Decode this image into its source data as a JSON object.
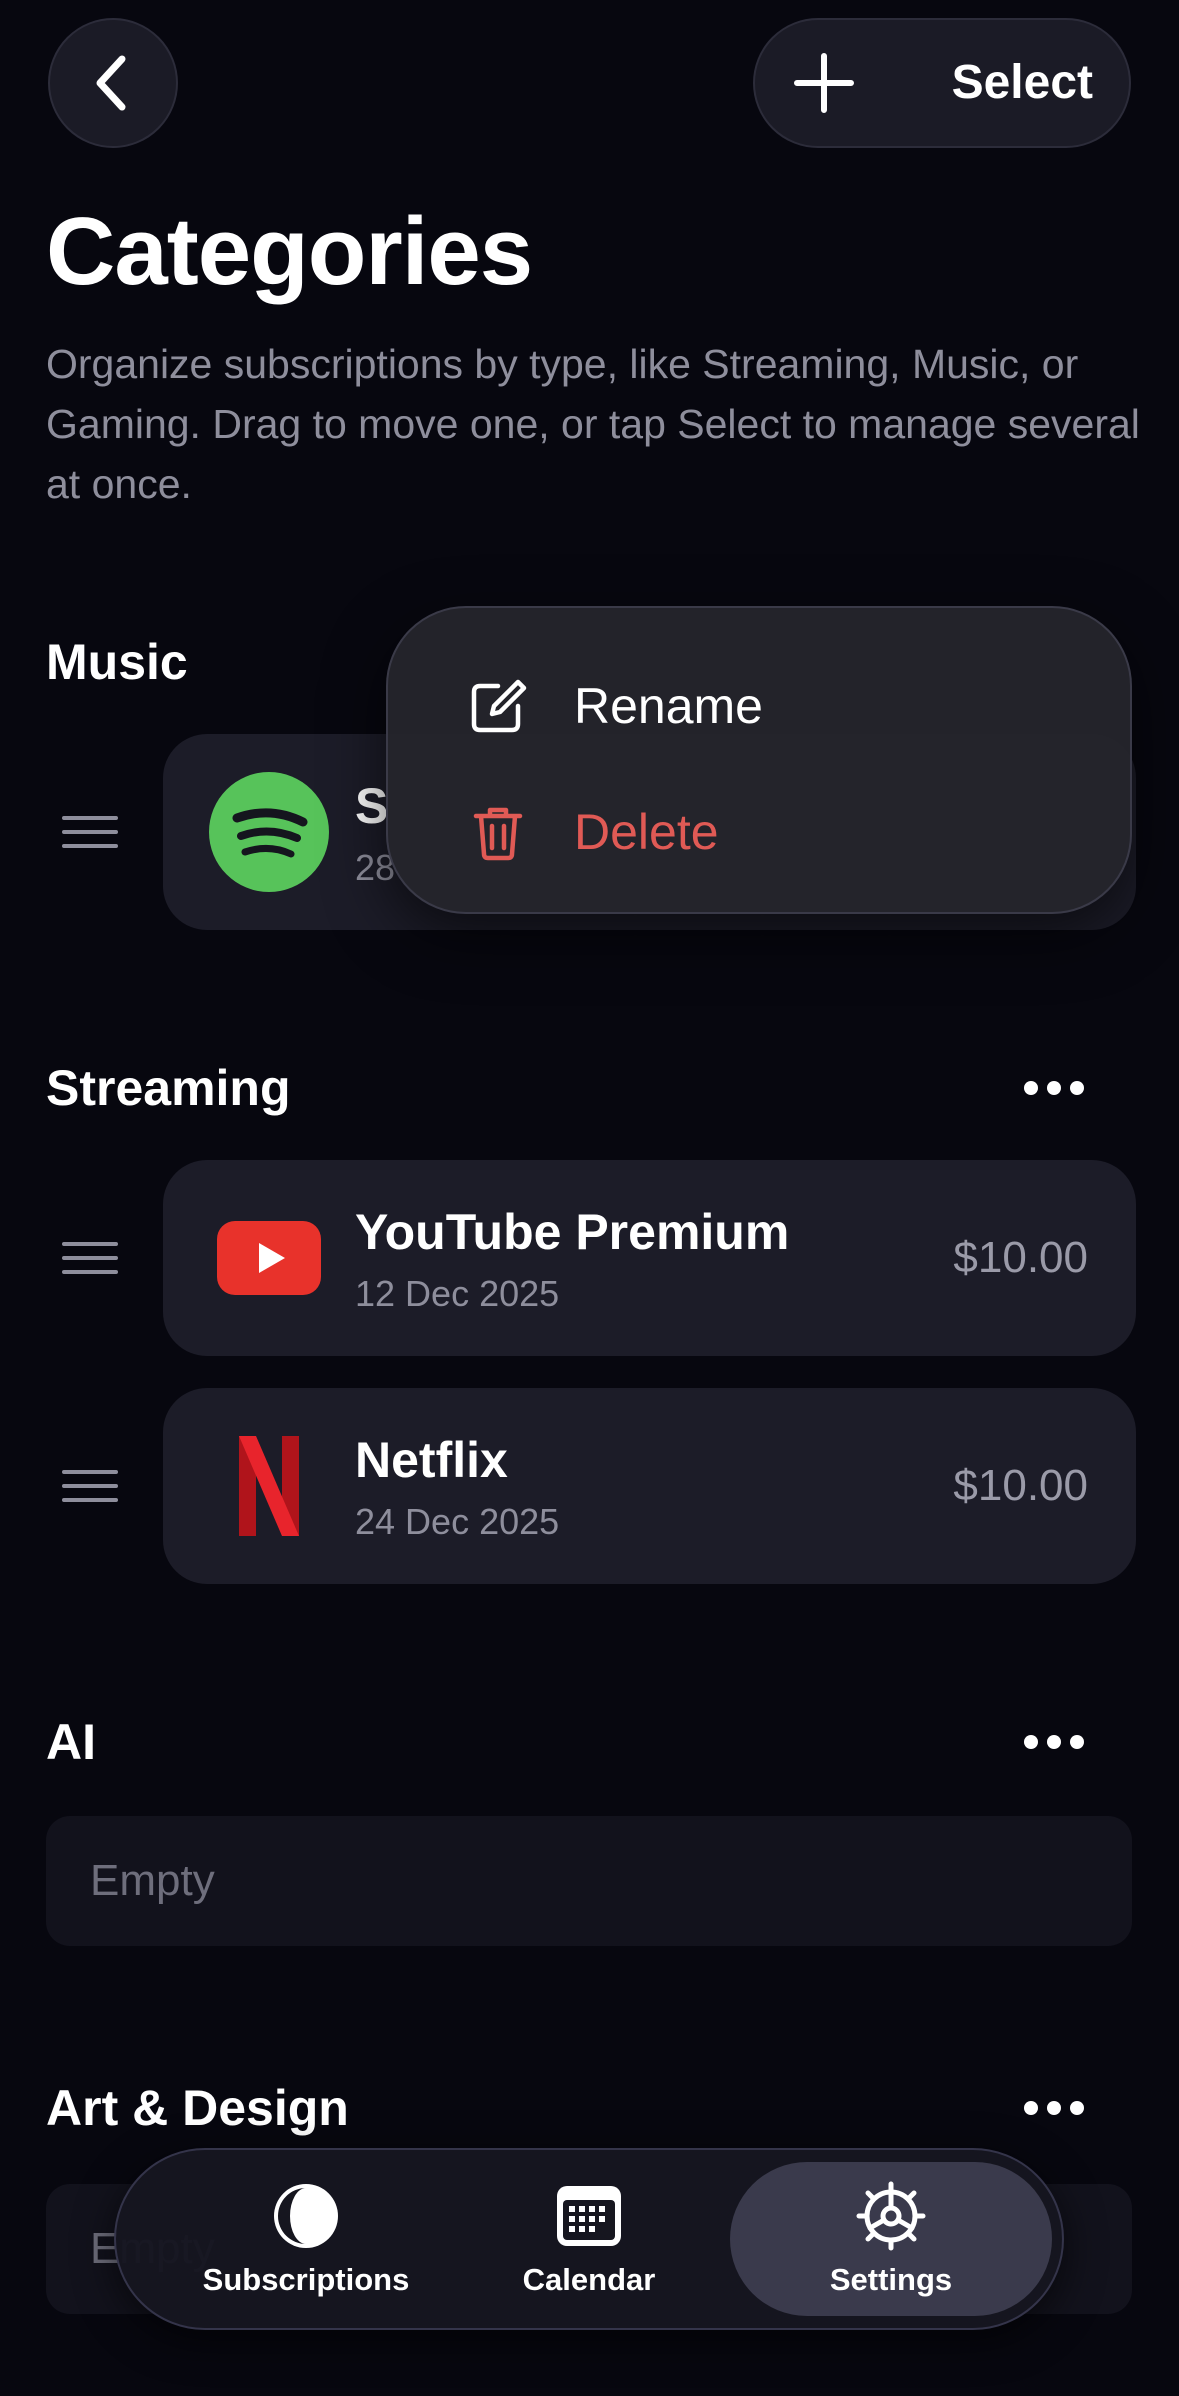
{
  "header": {
    "add_label": "Select",
    "title": "Categories",
    "description": "Organize subscriptions by type, like Streaming, Music, or Gaming. Drag to move one, or tap Select to manage several at once."
  },
  "sections": {
    "music": {
      "title": "Music",
      "items": [
        {
          "name": "S",
          "date": "28",
          "icon": "spotify-logo"
        }
      ]
    },
    "streaming": {
      "title": "Streaming",
      "items": [
        {
          "name": "YouTube Premium",
          "date": "12 Dec 2025",
          "price": "$10.00",
          "icon": "youtube-logo"
        },
        {
          "name": "Netflix",
          "date": "24 Dec 2025",
          "price": "$10.00",
          "icon": "netflix-logo"
        }
      ]
    },
    "ai": {
      "title": "AI",
      "empty_label": "Empty"
    },
    "art_design": {
      "title": "Art & Design",
      "empty_label": "Empty"
    }
  },
  "context_menu": {
    "rename_label": "Rename",
    "delete_label": "Delete"
  },
  "tabbar": {
    "tabs": [
      {
        "label": "Subscriptions",
        "icon": "subscriptions-icon"
      },
      {
        "label": "Calendar",
        "icon": "calendar-icon"
      },
      {
        "label": "Settings",
        "icon": "gear-icon",
        "active": true
      }
    ]
  },
  "colors": {
    "background": "#07070f",
    "card": "#1c1c28",
    "delete_red": "#e05a55",
    "spotify_green": "#57c35a",
    "youtube_red": "#e8322b",
    "netflix_red": "#d81f26"
  }
}
